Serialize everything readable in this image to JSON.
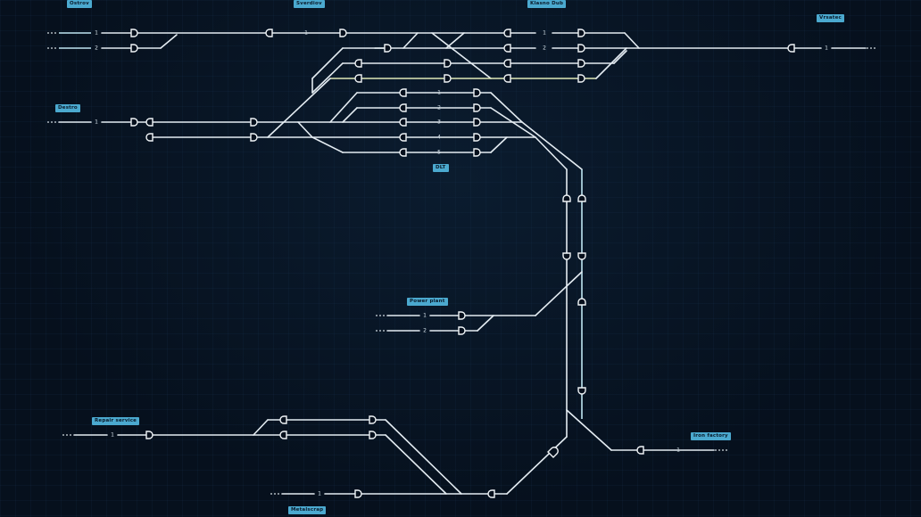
{
  "stations": {
    "ostrov": "Ostrov",
    "sverdiov": "Sverdiov",
    "klasno_dub": "Klasno Dub",
    "vrsatec": "Vrsatec",
    "destro": "Destro",
    "dlt": "DLT",
    "power_plant": "Power plant",
    "repair_service": "Repair service",
    "iron_factory": "Iron factory",
    "metalscrap": "Metalscrap"
  },
  "tracks": {
    "t1": "1",
    "t2": "2",
    "t3": "3",
    "t4": "4",
    "t5": "5"
  },
  "colors": {
    "background": "#06101d",
    "track": "#e4ecf2",
    "label_bg": "#4ba9cf",
    "label_text": "#0a1b2b"
  }
}
